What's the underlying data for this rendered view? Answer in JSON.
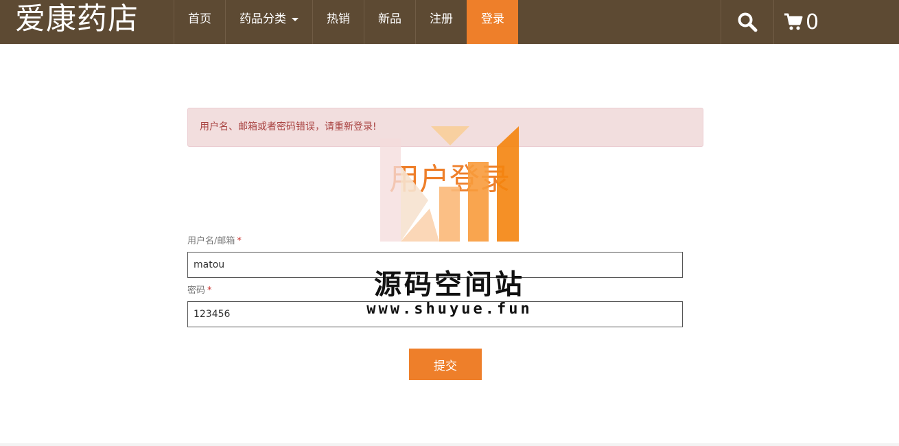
{
  "brand": "爱康药店",
  "nav": {
    "items": [
      {
        "label": "首页",
        "active": false
      },
      {
        "label": "药品分类",
        "dropdown": true,
        "active": false
      },
      {
        "label": "热销",
        "active": false
      },
      {
        "label": "新品",
        "active": false
      },
      {
        "label": "注册",
        "active": false
      },
      {
        "label": "登录",
        "active": true
      }
    ],
    "search_icon": "search-icon",
    "cart_icon": "cart-icon",
    "cart_count": "0"
  },
  "alert": {
    "message": "用户名、邮箱或者密码错误，请重新登录!"
  },
  "page_title": "用户登录",
  "form": {
    "username_label": "用户名/邮箱",
    "username_value": "matou",
    "password_label": "密码",
    "password_value": "123456",
    "required_mark": "*",
    "submit_label": "提交"
  },
  "watermark": {
    "name": "源码空间站",
    "url": "www.shuyue.fun"
  },
  "colors": {
    "navbar": "#5d4a33",
    "accent": "#ee7f2a",
    "alert_bg": "#f2dede",
    "alert_text": "#a94442"
  }
}
